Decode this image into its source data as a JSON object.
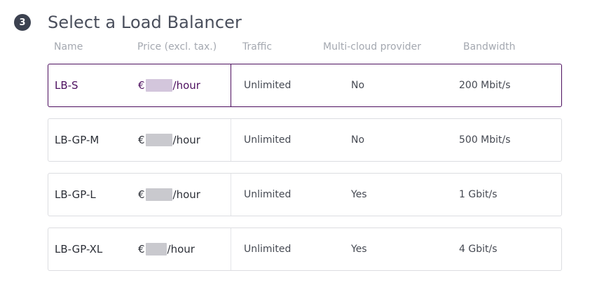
{
  "step": {
    "number": "3",
    "title": "Select a Load Balancer"
  },
  "columns": {
    "name": "Name",
    "price": "Price (excl. tax.)",
    "traffic": "Traffic",
    "multicloud": "Multi-cloud provider",
    "bandwidth": "Bandwidth"
  },
  "rows": [
    {
      "name": "LB-S",
      "currency": "€",
      "price_unit": "/hour",
      "traffic": "Unlimited",
      "multicloud": "No",
      "bandwidth": "200 Mbit/s",
      "selected": true
    },
    {
      "name": "LB-GP-M",
      "currency": "€",
      "price_unit": "/hour",
      "traffic": "Unlimited",
      "multicloud": "No",
      "bandwidth": "500 Mbit/s",
      "selected": false
    },
    {
      "name": "LB-GP-L",
      "currency": "€",
      "price_unit": "/hour",
      "traffic": "Unlimited",
      "multicloud": "Yes",
      "bandwidth": "1 Gbit/s",
      "selected": false
    },
    {
      "name": "LB-GP-XL",
      "currency": "€",
      "price_unit": "/hour",
      "traffic": "Unlimited",
      "multicloud": "Yes",
      "bandwidth": "4 Gbit/s",
      "selected": false
    }
  ],
  "colors": {
    "accent": "#4d0f5f",
    "badge": "#3c4250",
    "border": "#dcdde1"
  }
}
